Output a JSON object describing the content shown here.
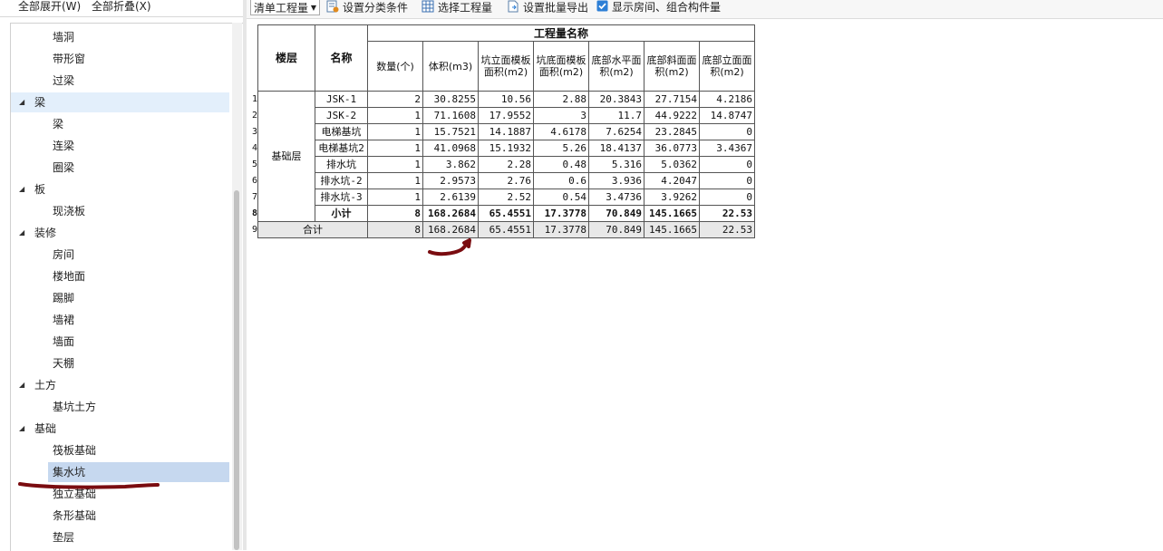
{
  "left_toolbar": {
    "expand_all": "全部展开(W)",
    "collapse_all": "全部折叠(X)"
  },
  "tree": [
    {
      "type": "child",
      "label": "墙洞"
    },
    {
      "type": "child",
      "label": "带形窗"
    },
    {
      "type": "child",
      "label": "过梁"
    },
    {
      "type": "cat",
      "label": "梁",
      "highlight": true
    },
    {
      "type": "child",
      "label": "梁"
    },
    {
      "type": "child",
      "label": "连梁"
    },
    {
      "type": "child",
      "label": "圈梁"
    },
    {
      "type": "cat",
      "label": "板"
    },
    {
      "type": "child",
      "label": "现浇板"
    },
    {
      "type": "cat",
      "label": "装修"
    },
    {
      "type": "child",
      "label": "房间"
    },
    {
      "type": "child",
      "label": "楼地面"
    },
    {
      "type": "child",
      "label": "踢脚"
    },
    {
      "type": "child",
      "label": "墙裙"
    },
    {
      "type": "child",
      "label": "墙面"
    },
    {
      "type": "child",
      "label": "天棚"
    },
    {
      "type": "cat",
      "label": "土方"
    },
    {
      "type": "child",
      "label": "基坑土方"
    },
    {
      "type": "cat",
      "label": "基础"
    },
    {
      "type": "child",
      "label": "筏板基础"
    },
    {
      "type": "child",
      "label": "集水坑",
      "selected": true
    },
    {
      "type": "child",
      "label": "独立基础"
    },
    {
      "type": "child",
      "label": "条形基础"
    },
    {
      "type": "child",
      "label": "垫层"
    }
  ],
  "toolbar": {
    "select_value": "清单工程量",
    "set_category": "设置分类条件",
    "choose_qty": "选择工程量",
    "batch_export": "设置批量导出",
    "show_rooms": "显示房间、组合构件量"
  },
  "table": {
    "header_group": "工程量名称",
    "col_floor": "楼层",
    "col_name": "名称",
    "columns": [
      "数量(个)",
      "体积(m3)",
      "坑立面模板面积(m2)",
      "坑底面模板面积(m2)",
      "底部水平面积(m2)",
      "底部斜面面积(m2)",
      "底部立面面积(m2)"
    ],
    "floor": "基础层",
    "rows": [
      {
        "n": "1",
        "name": "JSK-1",
        "vals": [
          "2",
          "30.8255",
          "10.56",
          "2.88",
          "20.3843",
          "27.7154",
          "4.2186"
        ]
      },
      {
        "n": "2",
        "name": "JSK-2",
        "vals": [
          "1",
          "71.1608",
          "17.9552",
          "3",
          "11.7",
          "44.9222",
          "14.8747"
        ]
      },
      {
        "n": "3",
        "name": "电梯基坑",
        "vals": [
          "1",
          "15.7521",
          "14.1887",
          "4.6178",
          "7.6254",
          "23.2845",
          "0"
        ]
      },
      {
        "n": "4",
        "name": "电梯基坑2",
        "vals": [
          "1",
          "41.0968",
          "15.1932",
          "5.26",
          "18.4137",
          "36.0773",
          "3.4367"
        ]
      },
      {
        "n": "5",
        "name": "排水坑",
        "vals": [
          "1",
          "3.862",
          "2.28",
          "0.48",
          "5.316",
          "5.0362",
          "0"
        ]
      },
      {
        "n": "6",
        "name": "排水坑-2",
        "vals": [
          "1",
          "2.9573",
          "2.76",
          "0.6",
          "3.936",
          "4.2047",
          "0"
        ]
      },
      {
        "n": "7",
        "name": "排水坑-3",
        "vals": [
          "1",
          "2.6139",
          "2.52",
          "0.54",
          "3.4736",
          "3.9262",
          "0"
        ]
      }
    ],
    "subtotal": {
      "n": "8",
      "label": "小计",
      "vals": [
        "8",
        "168.2684",
        "65.4551",
        "17.3778",
        "70.849",
        "145.1665",
        "22.53"
      ]
    },
    "total": {
      "n": "9",
      "label": "合计",
      "vals": [
        "8",
        "168.2684",
        "65.4551",
        "17.3778",
        "70.849",
        "145.1665",
        "22.53"
      ]
    }
  },
  "colors": {
    "annotation": "#7a0c10",
    "selected": "#c6d8ef",
    "highlight": "#e3effb",
    "checkbox": "#2d7fd6"
  }
}
